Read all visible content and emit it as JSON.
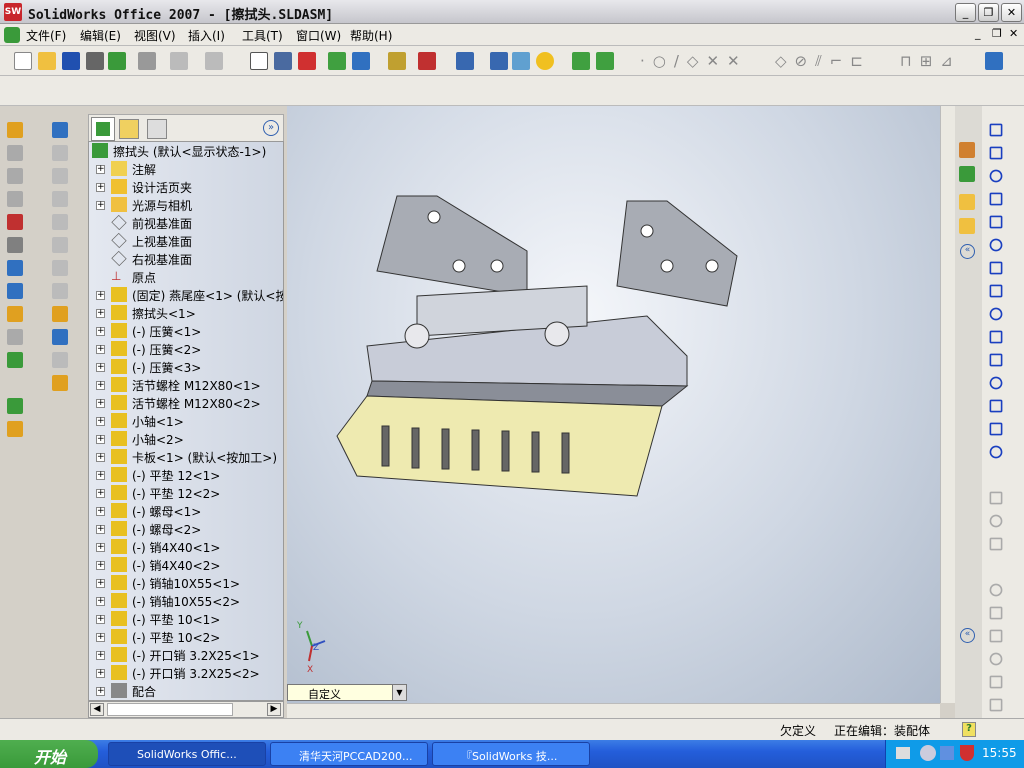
{
  "window": {
    "title": "SolidWorks Office 2007 - [擦拭头.SLDASM]",
    "logo": "SW"
  },
  "menu": [
    "文件(F)",
    "编辑(E)",
    "视图(V)",
    "插入(I)",
    "工具(T)",
    "窗口(W)",
    "帮助(H)"
  ],
  "tree": {
    "root": "擦拭头   (默认<显示状态-1>)",
    "items": [
      {
        "label": "注解",
        "icon": "annotation-icon",
        "expand": true
      },
      {
        "label": "设计活页夹",
        "icon": "design-binder-icon",
        "expand": true
      },
      {
        "label": "光源与相机",
        "icon": "lights-cameras-icon",
        "expand": true
      },
      {
        "label": "前视基准面",
        "icon": "plane-icon",
        "expand": false
      },
      {
        "label": "上视基准面",
        "icon": "plane-icon",
        "expand": false
      },
      {
        "label": "右视基准面",
        "icon": "plane-icon",
        "expand": false
      },
      {
        "label": "原点",
        "icon": "origin-icon",
        "expand": false
      },
      {
        "label": "(固定) 燕尾座<1> (默认<按",
        "icon": "part-icon",
        "expand": true
      },
      {
        "label": "擦拭头<1>",
        "icon": "part-icon",
        "expand": true
      },
      {
        "label": "(-) 压簧<1>",
        "icon": "part-icon",
        "expand": true
      },
      {
        "label": "(-) 压簧<2>",
        "icon": "part-icon",
        "expand": true
      },
      {
        "label": "(-) 压簧<3>",
        "icon": "part-icon",
        "expand": true
      },
      {
        "label": "活节螺栓 M12X80<1>",
        "icon": "part-icon",
        "expand": true
      },
      {
        "label": "活节螺栓 M12X80<2>",
        "icon": "part-icon",
        "expand": true
      },
      {
        "label": "小轴<1>",
        "icon": "part-icon",
        "expand": true
      },
      {
        "label": "小轴<2>",
        "icon": "part-icon",
        "expand": true
      },
      {
        "label": "卡板<1> (默认<按加工>)",
        "icon": "part-icon",
        "expand": true
      },
      {
        "label": "(-) 平垫 12<1>",
        "icon": "part-icon",
        "expand": true
      },
      {
        "label": "(-) 平垫 12<2>",
        "icon": "part-icon",
        "expand": true
      },
      {
        "label": "(-) 螺母<1>",
        "icon": "part-icon",
        "expand": true
      },
      {
        "label": "(-) 螺母<2>",
        "icon": "part-icon",
        "expand": true
      },
      {
        "label": "(-) 销4X40<1>",
        "icon": "part-icon",
        "expand": true
      },
      {
        "label": "(-) 销4X40<2>",
        "icon": "part-icon",
        "expand": true
      },
      {
        "label": "(-) 销轴10X55<1>",
        "icon": "part-icon",
        "expand": true
      },
      {
        "label": "(-) 销轴10X55<2>",
        "icon": "part-icon",
        "expand": true
      },
      {
        "label": "(-) 平垫 10<1>",
        "icon": "part-icon",
        "expand": true
      },
      {
        "label": "(-) 平垫 10<2>",
        "icon": "part-icon",
        "expand": true
      },
      {
        "label": "(-) 开口销 3.2X25<1>",
        "icon": "part-icon",
        "expand": true
      },
      {
        "label": "(-) 开口销 3.2X25<2>",
        "icon": "part-icon",
        "expand": true
      },
      {
        "label": "配合",
        "icon": "mates-icon",
        "expand": true
      }
    ]
  },
  "viewport": {
    "view_select": "自定义",
    "triad": {
      "x": "X",
      "y": "Y",
      "z": "Z"
    }
  },
  "status": {
    "state": "欠定义",
    "editing": "正在编辑：装配体"
  },
  "taskbar": {
    "start": "开始",
    "tasks": [
      "SolidWorks Offic...",
      "清华天河PCCAD200...",
      "『SolidWorks 技..."
    ],
    "clock": "15:55"
  },
  "colors": {
    "part": "#e8c020",
    "viewport_bg": "#cfd7e3",
    "taskbar": "#245edb"
  }
}
